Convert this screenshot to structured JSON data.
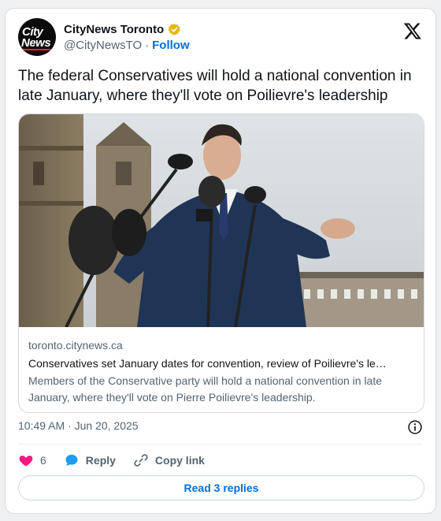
{
  "account": {
    "avatar_line1": "City",
    "avatar_line2": "News",
    "name": "CityNews Toronto",
    "handle": "@CityNewsTO",
    "separator": "·",
    "follow_label": "Follow"
  },
  "tweet": {
    "text": "The federal Conservatives will hold a national convention in late January, where they'll vote on Poilievre's leadership"
  },
  "link_card": {
    "domain": "toronto.citynews.ca",
    "title": "Conservatives set January dates for convention, review of Poilievre's le…",
    "description": "Members of the Conservative party will hold a national convention in late January, where they'll vote on Pierre Poilievre's leadership."
  },
  "meta": {
    "timestamp": "10:49 AM · Jun 20, 2025"
  },
  "actions": {
    "like_count": "6",
    "reply_label": "Reply",
    "copy_label": "Copy link"
  },
  "replies_button": "Read 3 replies",
  "icons": [
    "verified-badge-icon",
    "x-logo-icon",
    "info-icon",
    "heart-icon",
    "reply-icon",
    "link-icon"
  ],
  "colors": {
    "accent": "#006fd6",
    "heart": "#f91880",
    "muted": "#536471",
    "verified_gold": "#e2b719"
  }
}
